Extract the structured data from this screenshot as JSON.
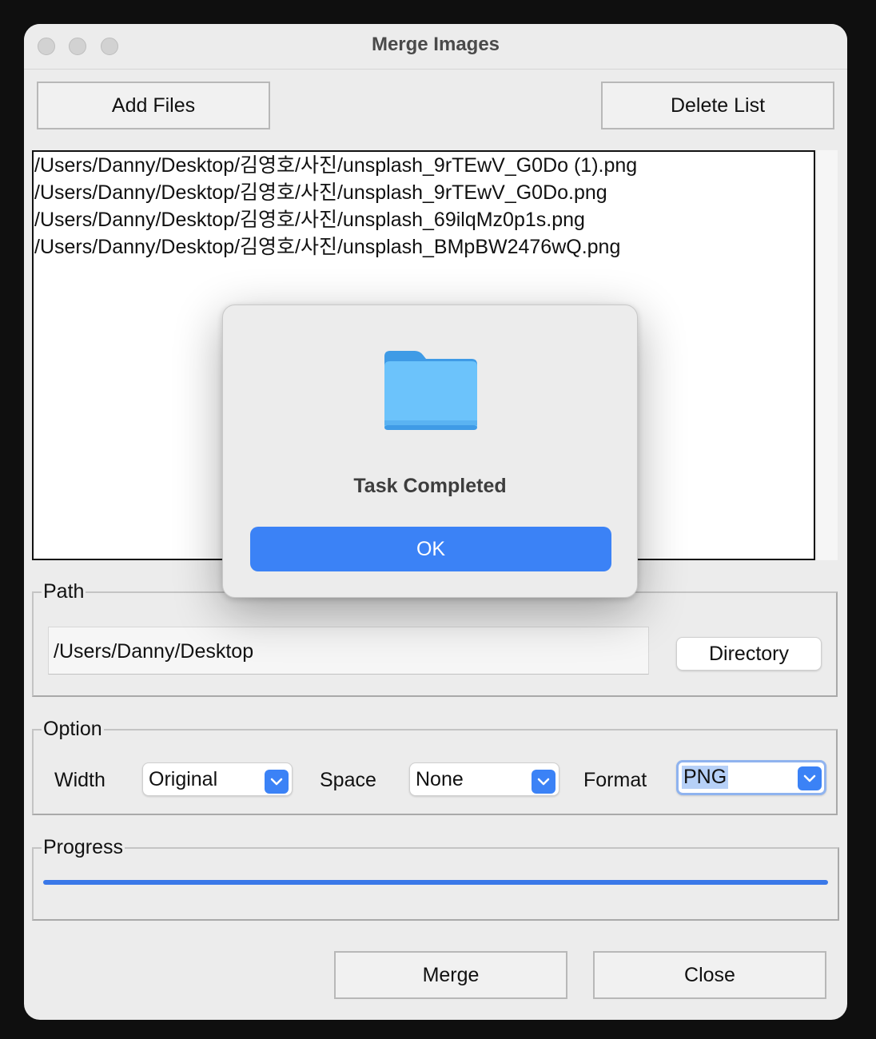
{
  "window": {
    "title": "Merge Images"
  },
  "toolbar": {
    "add_files": "Add Files",
    "delete_list": "Delete List"
  },
  "file_list": [
    "/Users/Danny/Desktop/김영호/사진/unsplash_9rTEwV_G0Do (1).png",
    "/Users/Danny/Desktop/김영호/사진/unsplash_9rTEwV_G0Do.png",
    "/Users/Danny/Desktop/김영호/사진/unsplash_69ilqMz0p1s.png",
    "/Users/Danny/Desktop/김영호/사진/unsplash_BMpBW2476wQ.png"
  ],
  "path": {
    "legend": "Path",
    "value": "/Users/Danny/Desktop",
    "directory_button": "Directory"
  },
  "option": {
    "legend": "Option",
    "width_label": "Width",
    "width_value": "Original",
    "space_label": "Space",
    "space_value": "None",
    "format_label": "Format",
    "format_value": "PNG"
  },
  "progress": {
    "legend": "Progress",
    "percent": 100
  },
  "actions": {
    "merge": "Merge",
    "close": "Close"
  },
  "dialog": {
    "icon": "folder-icon",
    "message": "Task Completed",
    "ok": "OK"
  },
  "colors": {
    "accent": "#3b82f6",
    "progress": "#3a78e8",
    "folder": "#5ab8f5"
  }
}
